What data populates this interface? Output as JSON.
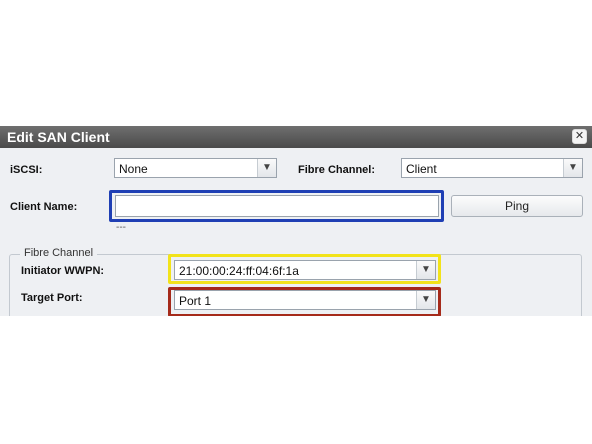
{
  "dialog": {
    "title": "Edit SAN Client",
    "close_icon": "close-icon",
    "iscsi": {
      "label": "iSCSI:",
      "selected": "None"
    },
    "fibre_channel": {
      "label": "Fibre Channel:",
      "selected": "Client"
    },
    "client_name": {
      "label": "Client Name:",
      "value": "",
      "hint": "---"
    },
    "ping_label": "Ping",
    "fc_group": {
      "legend": "Fibre Channel",
      "initiator_wwpn": {
        "label": "Initiator WWPN:",
        "selected": "21:00:00:24:ff:04:6f:1a"
      },
      "target_port": {
        "label": "Target Port:",
        "selected": "Port 1"
      }
    }
  },
  "colors": {
    "highlight_client_name": "#1f3fb4",
    "highlight_wwpn": "#f2e31a",
    "highlight_target_port": "#a52a1a"
  }
}
